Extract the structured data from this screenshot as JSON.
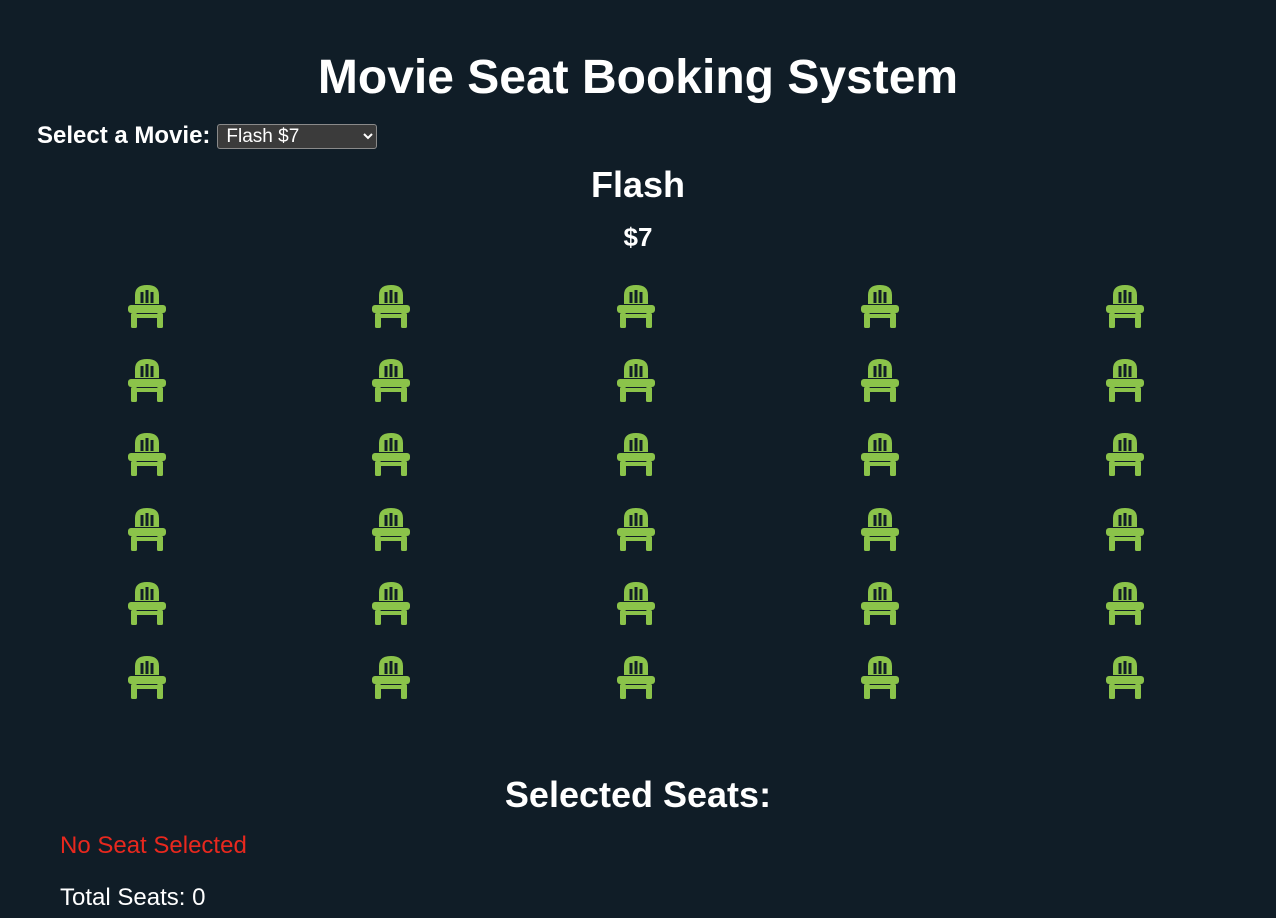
{
  "page": {
    "title": "Movie Seat Booking System"
  },
  "movie_select": {
    "label": "Select a Movie:",
    "selected": "Flash $7"
  },
  "movie": {
    "name": "Flash",
    "price": "$7"
  },
  "seats": {
    "rows": 6,
    "columns": 5,
    "icon": "chair-icon",
    "available_color": "#8bc34a",
    "selected_count": 0
  },
  "selection": {
    "heading": "Selected Seats:",
    "empty_message": "No Seat Selected",
    "total_label": "Total Seats: 0"
  },
  "colors": {
    "background": "#101d27",
    "text": "#ffffff",
    "error": "#e8281e"
  }
}
